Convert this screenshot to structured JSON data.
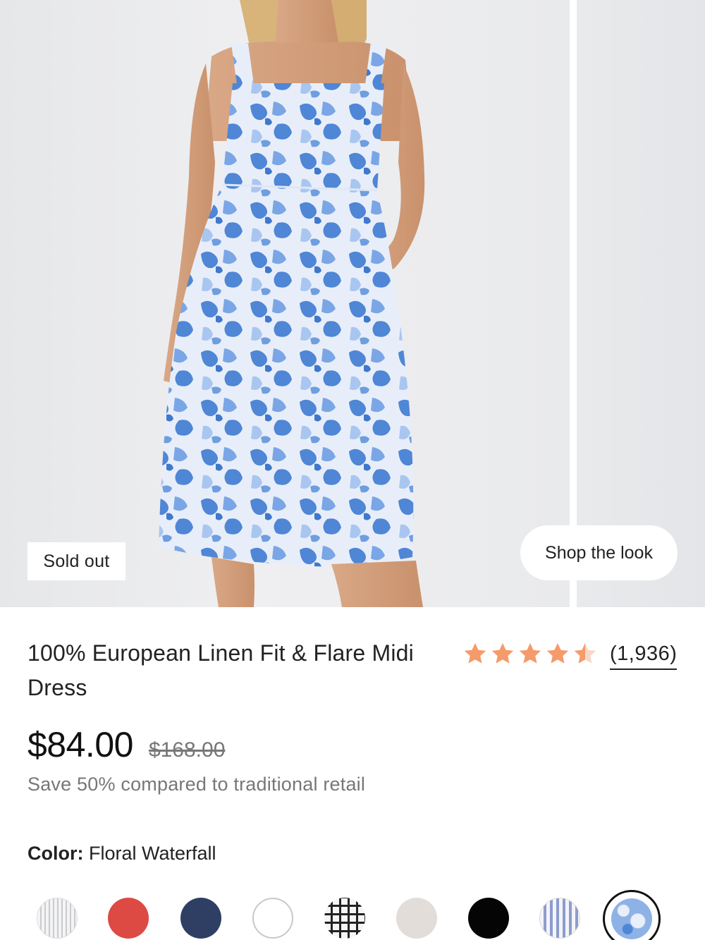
{
  "gallery": {
    "badge": "Sold out",
    "shop_look_label": "Shop the look"
  },
  "product": {
    "title": "100% European Linen Fit & Flare Midi Dress",
    "rating": 4.5,
    "review_count": "(1,936)",
    "price": "$84.00",
    "original_price": "$168.00",
    "savings": "Save 50% compared to traditional retail",
    "color_label": "Color:",
    "color_value": "Floral Waterfall"
  },
  "swatches": [
    {
      "name": "white-grey-stripe"
    },
    {
      "name": "red"
    },
    {
      "name": "navy"
    },
    {
      "name": "white"
    },
    {
      "name": "black-white-gingham"
    },
    {
      "name": "oatmeal"
    },
    {
      "name": "black"
    },
    {
      "name": "blue-white-stripe"
    },
    {
      "name": "floral-waterfall",
      "selected": true
    }
  ],
  "colors": {
    "star": "#f59a6a",
    "star_empty": "#f6d8c6",
    "swatch_red": "#dd4a44",
    "swatch_navy": "#2f3f63",
    "swatch_oatmeal": "#e2ddd8",
    "swatch_floral": "#8fb2e6"
  }
}
